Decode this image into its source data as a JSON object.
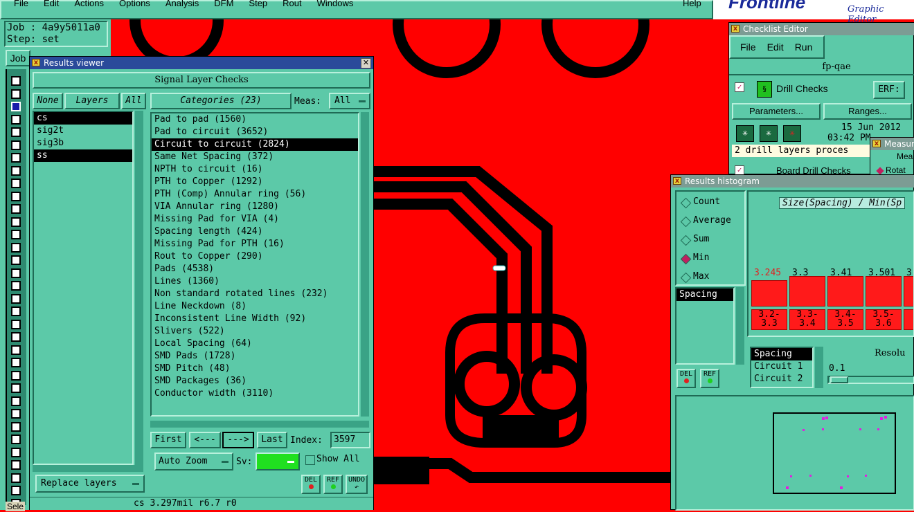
{
  "menu": {
    "items": [
      "File",
      "Edit",
      "Actions",
      "Options",
      "Analysis",
      "DFM",
      "Step",
      "Rout",
      "Windows"
    ],
    "help": "Help",
    "brand": "Frontline",
    "brand_sub": "Graphic Editor"
  },
  "job": {
    "job_line": "Job : 4a9y5011a0",
    "step_line": "Step: set",
    "job_button": "Job"
  },
  "bottom_left": {
    "sel": "Sele"
  },
  "results_viewer": {
    "title": "Results viewer",
    "header": "Signal Layer Checks",
    "layers_none": "None",
    "layers_label": "Layers",
    "layers_all": "All",
    "layers": [
      "cs",
      "sig2t",
      "sig3b",
      "ss"
    ],
    "categories_label": "Categories (23)",
    "meas_label": "Meas:",
    "meas_value": "All",
    "categories": [
      "Pad to pad (1560)",
      "Pad to circuit (3652)",
      "Circuit to circuit (2824)",
      "Same Net Spacing (372)",
      "NPTH to circuit (16)",
      "PTH to Copper (1292)",
      "PTH (Comp) Annular ring (56)",
      "VIA Annular ring (1280)",
      "Missing Pad for VIA (4)",
      "Spacing length (424)",
      "Missing Pad for PTH (16)",
      "Rout to Copper (290)",
      "Pads (4538)",
      "Lines (1360)",
      "Non standard rotated lines (232)",
      "Line Neckdown (8)",
      "Inconsistent Line Width (92)",
      "Slivers (522)",
      "Local Spacing (64)",
      "SMD Pads (1728)",
      "SMD Pitch (48)",
      "SMD Packages (36)",
      "Conductor width (3110)"
    ],
    "nav": {
      "first": "First",
      "prev": "<---",
      "next": "--->",
      "last": "Last",
      "index_label": "Index:",
      "index_value": "3597"
    },
    "auto_zoom": "Auto Zoom",
    "sv_label": "Sv:",
    "show_all": "Show All",
    "replace_layers": "Replace layers",
    "del": "DEL",
    "ref": "REF",
    "undo": "UNDO",
    "status": "cs 3.297mil  r6.7  r0"
  },
  "checklist_editor": {
    "title": "Checklist Editor",
    "menu": [
      "File",
      "Edit",
      "Run"
    ],
    "name": "fp-qae",
    "drill_checks": "Drill Checks",
    "erf": "ERF:",
    "parameters": "Parameters...",
    "ranges": "Ranges...",
    "date": "15 Jun 2012",
    "time": "03:42 PM",
    "message": "2 drill layers proces",
    "board_drill": "Board Drill Checks"
  },
  "measure_window": {
    "title": "Measur",
    "label": "Mea",
    "item": "Rotat"
  },
  "histogram": {
    "title": "Results histogram",
    "options": [
      "Count",
      "Average",
      "Sum",
      "Min",
      "Max"
    ],
    "selected_option": "Min",
    "metric_list": [
      "Spacing"
    ],
    "chart_title": "Size(Spacing) / Min(Sp",
    "bar_values": [
      "3.245",
      "3.3",
      "3.41",
      "3.501",
      "3"
    ],
    "bin_labels_top": [
      "3.2-",
      "3.3-",
      "3.4-",
      "3.5-",
      "3"
    ],
    "bin_labels_bottom": [
      "3.3",
      "3.4",
      "3.5",
      "3.6",
      "3"
    ],
    "second_list": [
      "Spacing",
      "Circuit 1",
      "Circuit 2"
    ],
    "resolution_label": "Resolu",
    "resolution_value": "0.1",
    "del": "DEL",
    "ref": "REF"
  },
  "colors": {
    "board_red": "#ff0000",
    "panel": "#5cc9a8",
    "title_active": "#2a4a9a",
    "marker": "#e020e0"
  }
}
